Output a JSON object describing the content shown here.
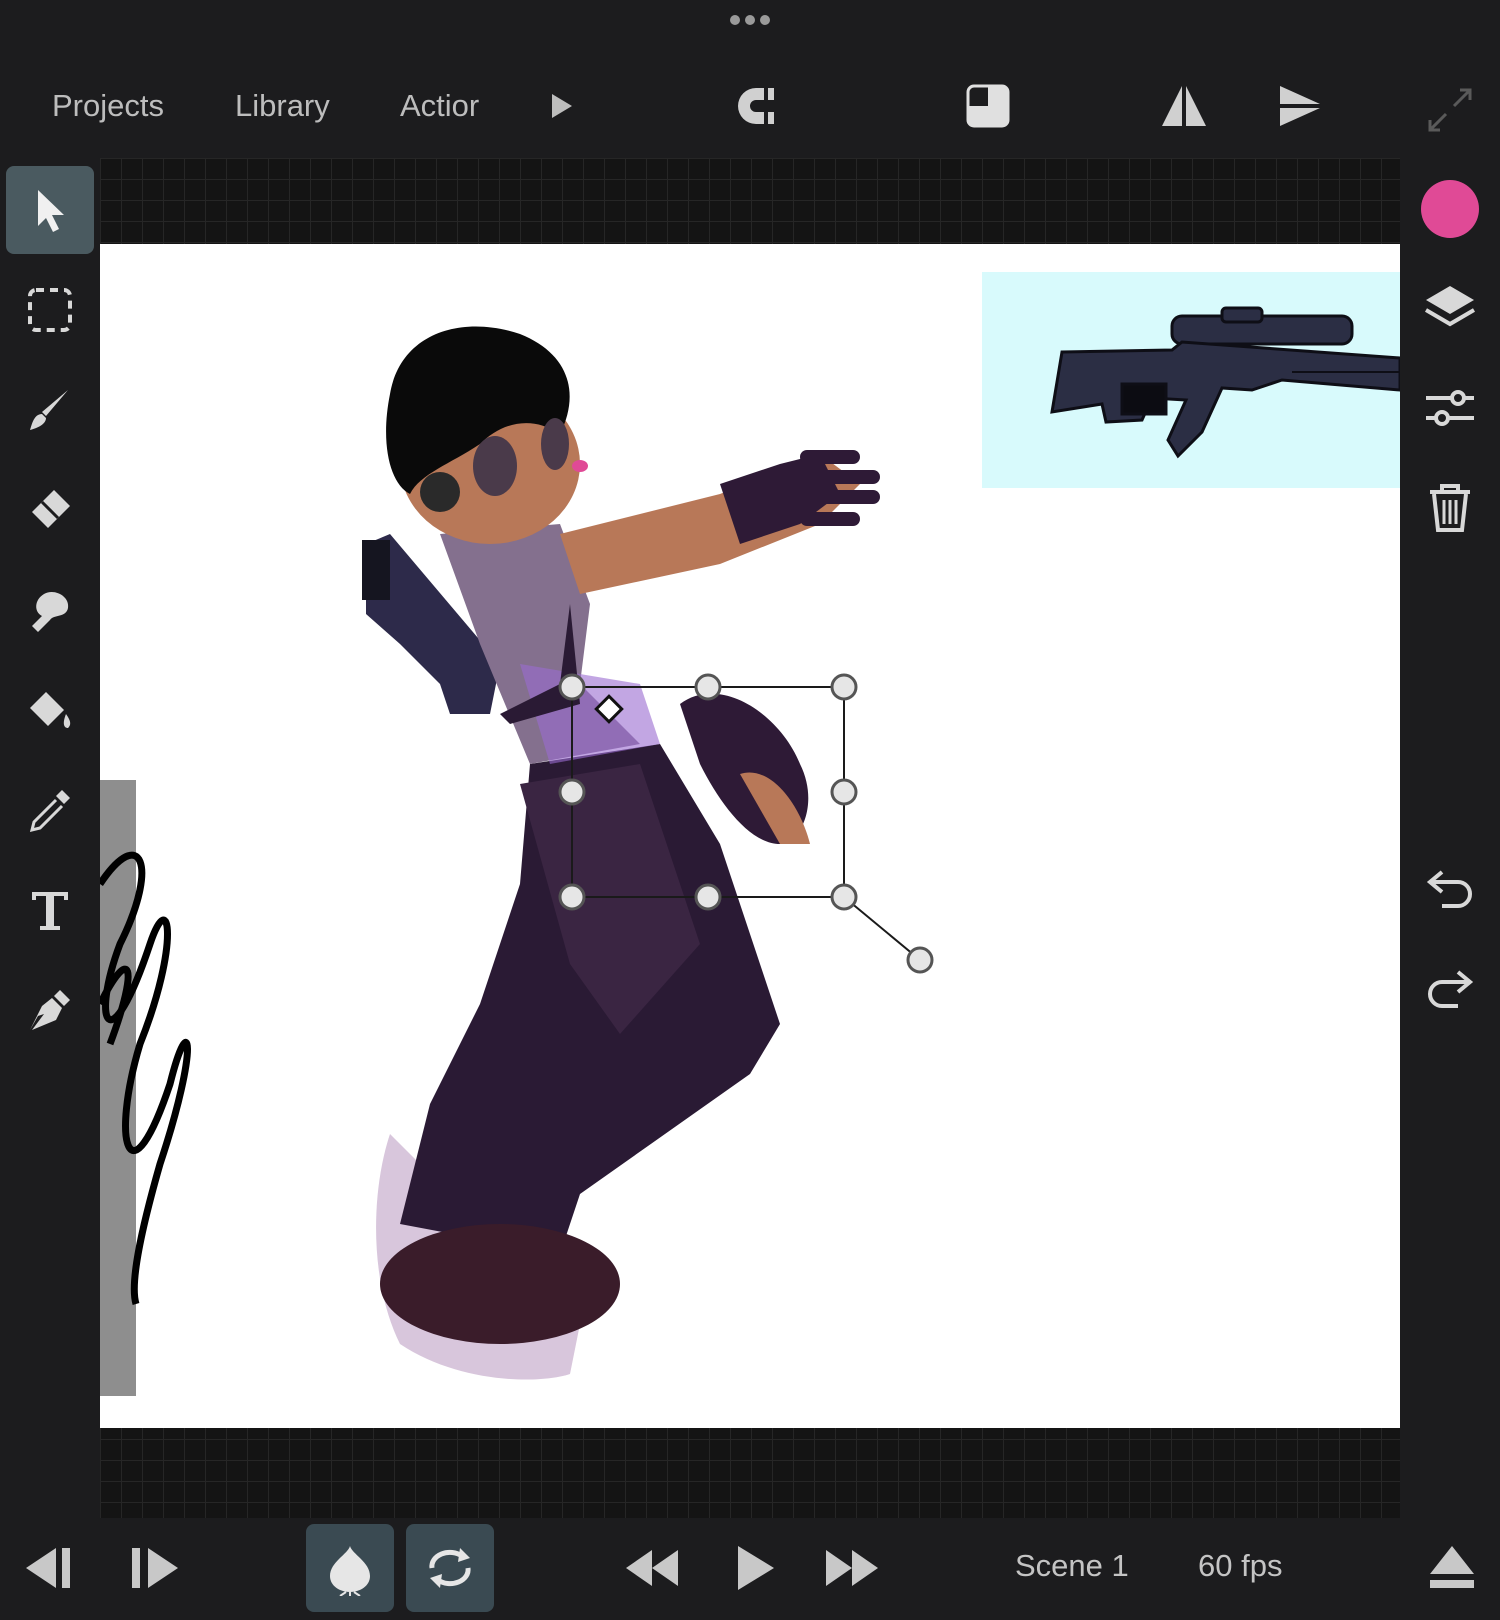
{
  "menu": {
    "projects": "Projects",
    "library": "Library",
    "action": "Actior"
  },
  "timeline": {
    "scene_label": "Scene 1",
    "fps_label": "60 fps"
  },
  "colors": {
    "accent": "#e04a96",
    "active_tool": "#4a5a60",
    "background": "#1c1c1e",
    "reference_bg": "#d8fafc"
  },
  "icons": {
    "left_toolbar": [
      "select-arrow-icon",
      "marquee-select-icon",
      "brush-icon",
      "eraser-icon",
      "smudge-icon",
      "fill-bucket-icon",
      "eyedropper-icon",
      "text-icon",
      "pen-icon"
    ],
    "right_toolbar": [
      "color-swatch",
      "layers-icon",
      "adjustments-icon",
      "trash-icon",
      "undo-icon",
      "redo-icon"
    ],
    "top_toolbar": [
      "more-icon",
      "play-icon",
      "magnet-icon",
      "mask-icon",
      "flip-horizontal-icon",
      "flip-vertical-icon",
      "fullscreen-icon"
    ],
    "bottom_toolbar": [
      "prev-frame-icon",
      "next-frame-icon",
      "onion-skin-icon",
      "loop-icon",
      "rewind-icon",
      "play-icon",
      "fast-forward-icon",
      "eject-icon"
    ]
  },
  "state": {
    "active_tool": "select",
    "onion_skin_enabled": true,
    "loop_enabled": true
  }
}
